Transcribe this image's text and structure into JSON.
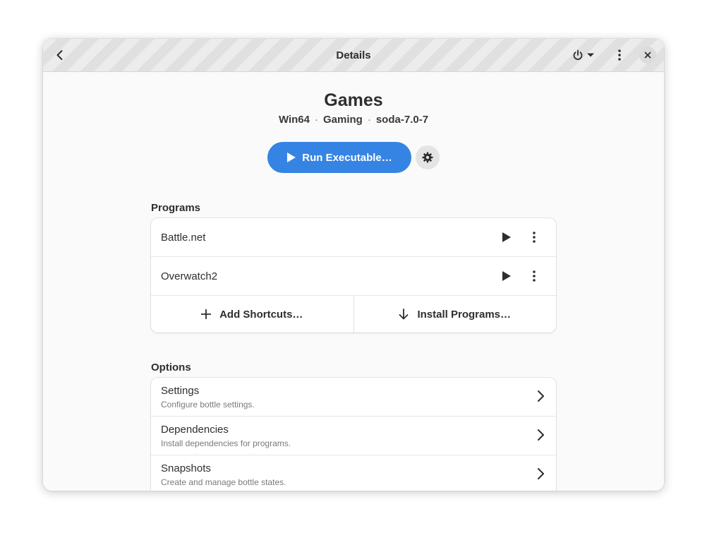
{
  "header": {
    "title": "Details"
  },
  "bottle": {
    "name": "Games",
    "arch": "Win64",
    "environment": "Gaming",
    "runner": "soda-7.0-7",
    "separator": "·"
  },
  "run_button": {
    "label": "Run Executable…"
  },
  "programs": {
    "section_label": "Programs",
    "items": [
      {
        "name": "Battle.net"
      },
      {
        "name": "Overwatch2"
      }
    ],
    "add_shortcuts_label": "Add Shortcuts…",
    "install_programs_label": "Install Programs…"
  },
  "options": {
    "section_label": "Options",
    "items": [
      {
        "title": "Settings",
        "subtitle": "Configure bottle settings."
      },
      {
        "title": "Dependencies",
        "subtitle": "Install dependencies for programs."
      },
      {
        "title": "Snapshots",
        "subtitle": "Create and manage bottle states."
      }
    ]
  },
  "colors": {
    "accent": "#3584e4"
  },
  "icons": [
    "back-icon",
    "power-icon",
    "dropdown-arrow-icon",
    "menu-icon",
    "close-icon",
    "play-icon",
    "gear-icon",
    "kebab-icon",
    "plus-icon",
    "download-arrow-icon",
    "chevron-right-icon"
  ]
}
